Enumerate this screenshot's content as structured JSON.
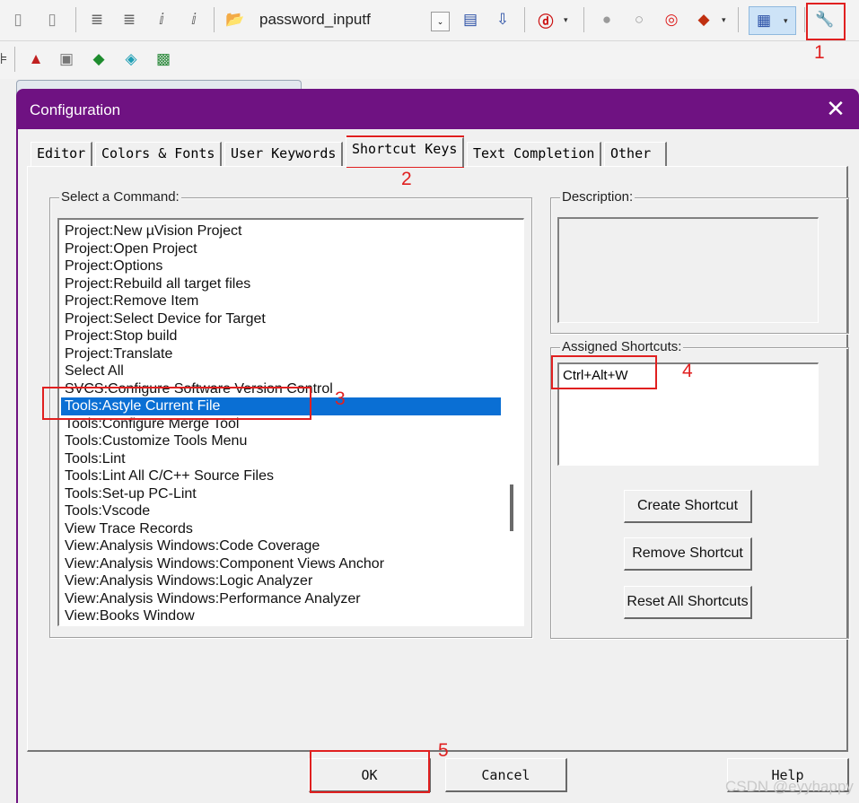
{
  "toolbar": {
    "file_combo_value": "password_inputf",
    "file_combo_arrow": "⌄",
    "dropdown_arrow": "▾",
    "accent_color": "#cde3f7"
  },
  "dialog": {
    "title": "Configuration",
    "close_glyph": "✕",
    "title_bar_color": "#6f1282",
    "tabs": [
      "Editor",
      "Colors & Fonts",
      "User Keywords",
      "Shortcut Keys",
      "Text Completion",
      "Other"
    ],
    "active_tab": "Shortcut Keys",
    "select_command_label": "Select a Command:",
    "commands": [
      "Project:New µVision Project",
      "Project:Open Project",
      "Project:Options",
      "Project:Rebuild all target files",
      "Project:Remove Item",
      "Project:Select Device for Target",
      "Project:Stop build",
      "Project:Translate",
      "Select All",
      "SVCS:Configure Software Version Control",
      "Tools:Astyle Current File",
      "Tools:Configure Merge Tool",
      "Tools:Customize Tools Menu",
      "Tools:Lint",
      "Tools:Lint All C/C++ Source Files",
      "Tools:Set-up PC-Lint",
      "Tools:Vscode",
      "View Trace Records",
      "View:Analysis Windows:Code Coverage",
      "View:Analysis Windows:Component Views Anchor",
      "View:Analysis Windows:Logic Analyzer",
      "View:Analysis Windows:Performance Analyzer",
      "View:Books Window"
    ],
    "selected_command": "Tools:Astyle Current File",
    "selection_color": "#0a6fd4",
    "description_label": "Description:",
    "assigned_shortcuts_label": "Assigned Shortcuts:",
    "assigned_shortcuts": [
      "Ctrl+Alt+W"
    ],
    "create_shortcut_label": "Create Shortcut",
    "remove_shortcut_label": "Remove Shortcut",
    "reset_shortcuts_label": "Reset All Shortcuts",
    "ok_label": "OK",
    "cancel_label": "Cancel",
    "help_label": "Help"
  },
  "annotations": {
    "color": "#e02020",
    "labels": [
      "1",
      "2",
      "3",
      "4",
      "5"
    ]
  },
  "watermark": "CSDN @eyyhappy",
  "icons": {
    "tb_uncomment": "▯",
    "tb_indent": "≣",
    "tb_italic": "ⅈ",
    "tb_folder": "📂",
    "tb_doc": "▤",
    "tb_download": "⇩",
    "tb_debug": "ⓓ",
    "tb_bp": "●",
    "tb_bp_off": "○",
    "tb_bp_kill": "◎",
    "tb_bp_color": "◆",
    "tb_window": "▦",
    "tb_wrench": "🔧",
    "tb2_ruler": "⊧",
    "tb2_build": "▲",
    "tb2_layers": "▣",
    "tb2_diamond": "◆",
    "tb2_pack": "◈",
    "tb2_grid": "▩"
  }
}
